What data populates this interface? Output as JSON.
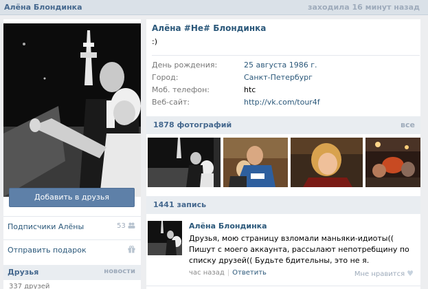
{
  "topbar": {
    "name": "Алёна Блондинка",
    "last_seen": "заходила 16 минут назад"
  },
  "left": {
    "add_friend_label": "Добавить в друзья",
    "subscribers_label": "Подписчики Алёны",
    "subscribers_count": "53",
    "gift_label": "Отправить подарок",
    "friends_title": "Друзья",
    "friends_news": "новости",
    "friends_count": "337 друзей"
  },
  "profile": {
    "name": "Алёна #Не# Блондинка",
    "status": ":)",
    "info": [
      {
        "key": "День рождения:",
        "value": "25 августа 1986 г."
      },
      {
        "key": "Город:",
        "value": "Санкт-Петербург"
      },
      {
        "key": "Моб. телефон:",
        "value": "htc"
      },
      {
        "key": "Веб-сайт:",
        "value": "http://vk.com/tour4f"
      }
    ]
  },
  "photos": {
    "title": "1878 фотографий",
    "all_label": "все"
  },
  "wall": {
    "title": "1441 запись",
    "post": {
      "author": "Алёна Блондинка",
      "text": "Друзья, мою страницу взломали маньяки-идиоты(( Пишут с моего аккаунта, рассылают непотребщину по списку друзей(( Будьте бдительны, это не я.",
      "time": "час назад",
      "reply_label": "Ответить",
      "like_label": "Мне нравится"
    }
  },
  "icons": {
    "subscribers": "people-icon",
    "gift": "gift-icon",
    "like": "heart-icon"
  }
}
